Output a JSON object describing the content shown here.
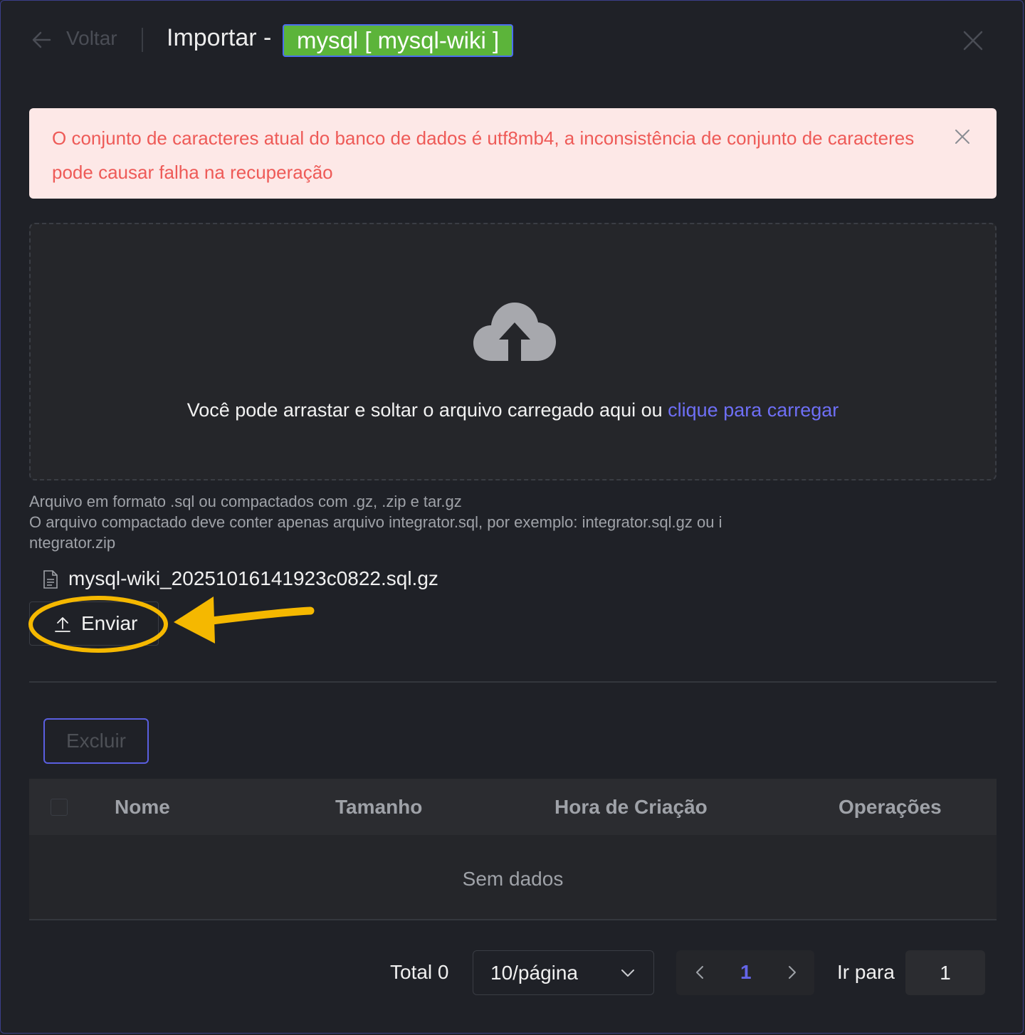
{
  "header": {
    "back_label": "Voltar",
    "title": "Importar -",
    "db_tag": "mysql [ mysql-wiki ]",
    "tag_color": "#5cb43a"
  },
  "alert": {
    "message": "O conjunto de caracteres atual do banco de dados é utf8mb4, a inconsistência de conjunto de caracteres pode causar falha na recuperação",
    "color": "#ee5a57"
  },
  "dropzone": {
    "text": "Você pode arrastar e soltar o arquivo carregado aqui ou ",
    "link": "clique para carregar",
    "link_color": "#6e6ff5",
    "icon": "cloud-upload-icon"
  },
  "hint": {
    "line1": "Arquivo em formato .sql ou compactados com .gz, .zip e tar.gz",
    "line2": "O arquivo compactado deve conter apenas arquivo integrator.sql, por exemplo: integrator.sql.gz ou i",
    "line3": "ntegrator.zip"
  },
  "file": {
    "name": "mysql-wiki_20251016141923c0822.sql.gz",
    "icon": "file-icon"
  },
  "actions": {
    "send_label": "Enviar",
    "delete_label": "Excluir"
  },
  "annotation": {
    "color": "#f5b800"
  },
  "table": {
    "columns": [
      "Nome",
      "Tamanho",
      "Hora de Criação",
      "Operações"
    ],
    "rows": [],
    "empty_text": "Sem dados"
  },
  "pagination": {
    "total_label": "Total 0",
    "page_size": "10/página",
    "current_page": "1",
    "goto_label": "Ir para",
    "goto_value": "1"
  }
}
